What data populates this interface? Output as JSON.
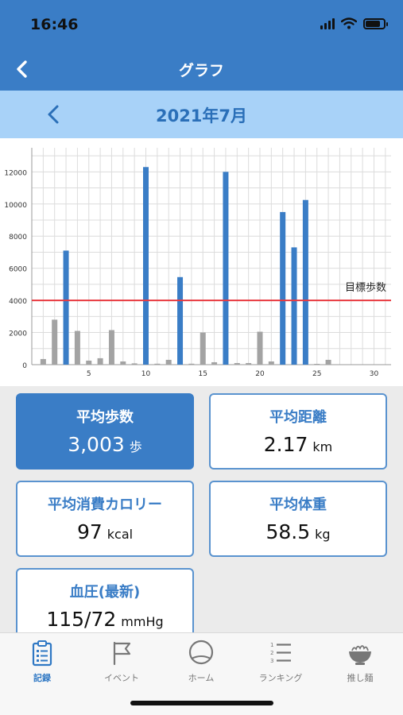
{
  "status_bar": {
    "time": "16:46"
  },
  "nav": {
    "title": "グラフ"
  },
  "month": {
    "title": "2021年7月"
  },
  "chart_data": {
    "type": "bar",
    "x": [
      1,
      2,
      3,
      4,
      5,
      6,
      7,
      8,
      9,
      10,
      11,
      12,
      13,
      14,
      15,
      16,
      17,
      18,
      19,
      20,
      21,
      22,
      23,
      24,
      25,
      26,
      27,
      28,
      29,
      30,
      31
    ],
    "values": [
      350,
      2800,
      7100,
      2100,
      250,
      400,
      2150,
      200,
      80,
      12300,
      60,
      300,
      5450,
      60,
      2000,
      150,
      12000,
      100,
      100,
      2050,
      200,
      9500,
      7300,
      10250,
      50,
      300,
      0,
      0,
      0,
      0,
      0
    ],
    "highlight_days": [
      3,
      10,
      13,
      17,
      22,
      23,
      24
    ],
    "xticks": [
      5,
      10,
      15,
      20,
      25,
      30
    ],
    "yticks": [
      0,
      2000,
      4000,
      6000,
      8000,
      10000,
      12000
    ],
    "ylim": [
      0,
      13500
    ],
    "xlim": [
      0,
      31.5
    ],
    "target": 4000,
    "target_label": "目標歩数",
    "colors": {
      "highlight": "#3a7dc6",
      "normal": "#a3a3a3",
      "target": "#e8393f",
      "grid": "#dcdcdc"
    },
    "grid": true
  },
  "cards": {
    "avg_steps": {
      "title": "平均歩数",
      "value": "3,003",
      "unit": "歩"
    },
    "avg_distance": {
      "title": "平均距離",
      "value": "2.17",
      "unit": "km"
    },
    "avg_calories": {
      "title": "平均消費カロリー",
      "value": "97",
      "unit": "kcal"
    },
    "avg_weight": {
      "title": "平均体重",
      "value": "58.5",
      "unit": "kg"
    },
    "blood_pressure": {
      "title": "血圧(最新)",
      "value": "115/72",
      "unit": "mmHg"
    }
  },
  "tabs": [
    {
      "label": "記録",
      "icon": "clipboard-icon"
    },
    {
      "label": "イベント",
      "icon": "flag-icon"
    },
    {
      "label": "ホーム",
      "icon": "home-circle-icon"
    },
    {
      "label": "ランキング",
      "icon": "ranking-list-icon"
    },
    {
      "label": "推し麺",
      "icon": "noodle-bowl-icon"
    }
  ]
}
